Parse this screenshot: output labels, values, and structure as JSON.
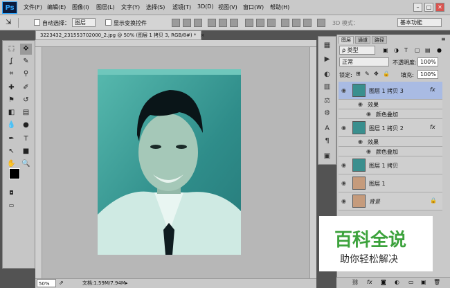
{
  "app": {
    "logo": "Ps"
  },
  "menu": [
    "文件(F)",
    "编辑(E)",
    "图像(I)",
    "图层(L)",
    "文字(Y)",
    "选择(S)",
    "滤镜(T)",
    "3D(D)",
    "视图(V)",
    "窗口(W)",
    "帮助(H)"
  ],
  "window_controls": {
    "minimize": "–",
    "maximize": "□",
    "close": "✕"
  },
  "options": {
    "auto_select_label": "自动选择：",
    "auto_select_value": "图层",
    "transform_label": "显示变换控件",
    "mode3d_label": "3D 模式：",
    "workspace": "基本功能"
  },
  "document": {
    "tab_title": "3223432_231553702000_2.jpg @ 50% (图层 1 拷贝 3, RGB/8#) *",
    "tab_close": "×",
    "zoom": "50%",
    "doc_size": "文档:1.59M/7.94M"
  },
  "panels": {
    "tabs": [
      "图层",
      "通道",
      "路径"
    ],
    "filter_label": "ρ 类型",
    "blend_mode": "正常",
    "opacity_label": "不透明度:",
    "opacity_value": "100%",
    "lock_label": "锁定:",
    "fill_label": "填充:",
    "fill_value": "100%",
    "effects_label": "效果",
    "effect_name": "颜色叠加",
    "fx_label": "fx",
    "layers": [
      {
        "name": "图层 1 拷贝 3",
        "selected": true,
        "fx": true
      },
      {
        "name": "图层 1 拷贝 2",
        "selected": false,
        "fx": true
      },
      {
        "name": "图层 1 拷贝",
        "selected": false,
        "fx": false
      },
      {
        "name": "图层 1",
        "selected": false,
        "fx": false
      },
      {
        "name": "背景",
        "selected": false,
        "fx": false,
        "locked": true
      }
    ]
  },
  "watermark": {
    "title": "百科全说",
    "subtitle": "助你轻松解决"
  },
  "colors": {
    "accent": "#31a8ff",
    "selected_layer": "#a9bbe3",
    "watermark_green": "#3ca23c"
  }
}
